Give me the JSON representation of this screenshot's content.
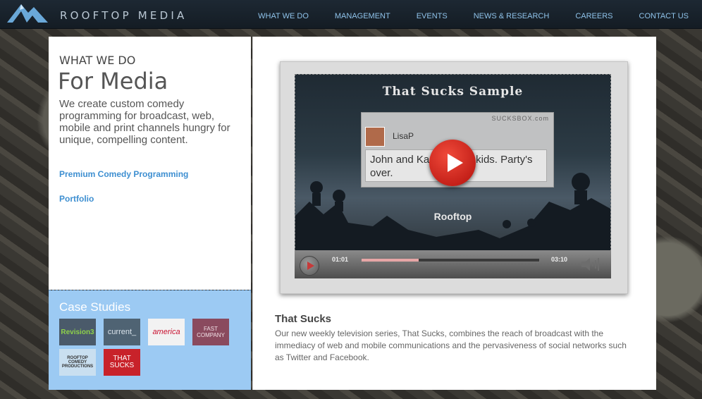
{
  "brand": {
    "name": "ROOFTOP MEDIA",
    "icon": "mountain-logo-icon"
  },
  "nav": [
    {
      "label": "WHAT WE DO"
    },
    {
      "label": "MANAGEMENT"
    },
    {
      "label": "EVENTS"
    },
    {
      "label": "NEWS & RESEARCH"
    },
    {
      "label": "CAREERS"
    },
    {
      "label": "CONTACT US"
    }
  ],
  "sidebar": {
    "section_label": "WHAT WE DO",
    "title": "For Media",
    "intro": "We create custom comedy programming for broadcast, web, mobile and print channels hungry for unique, compelling content.",
    "links": [
      {
        "label": "Premium Comedy Programming"
      },
      {
        "label": "Portfolio"
      }
    ]
  },
  "case_studies": {
    "title": "Case Studies",
    "items": [
      {
        "label": "Revision3",
        "color": "#4a5a6a",
        "text_color": "#8ed14a"
      },
      {
        "label": "current_",
        "color": "#4f6373",
        "text_color": "#d9e2ea"
      },
      {
        "label": "america",
        "color": "#f2f2f2",
        "text_color": "#c8102e"
      },
      {
        "label": "FAST COMPANY",
        "color": "#8a4a5e",
        "text_color": "#f0e0e6"
      },
      {
        "label": "ROOFTOP COMEDY PRODUCTIONS",
        "color": "#c9dff0",
        "text_color": "#333333"
      },
      {
        "label": "THAT SUCKS",
        "color": "#c8222a",
        "text_color": "#ffffff"
      }
    ]
  },
  "video": {
    "title": "That Sucks Sample",
    "brand": "SUCKSBOX.com",
    "user": "LisaP",
    "message": "John and Ka        u have 8 kids. Party's over.",
    "caption": "Rooftop",
    "current_time": "01:01",
    "duration": "03:10",
    "progress": 0.32
  },
  "description": {
    "title": "That Sucks",
    "text": "Our new weekly television series, That Sucks, combines the reach of broadcast with the immediacy of web and mobile communications and the pervasiveness of social networks such as Twitter and Facebook."
  },
  "colors": {
    "accent": "#3e8fd1",
    "nav": "#8fc3ea",
    "case_panel": "#9ccaf3"
  }
}
